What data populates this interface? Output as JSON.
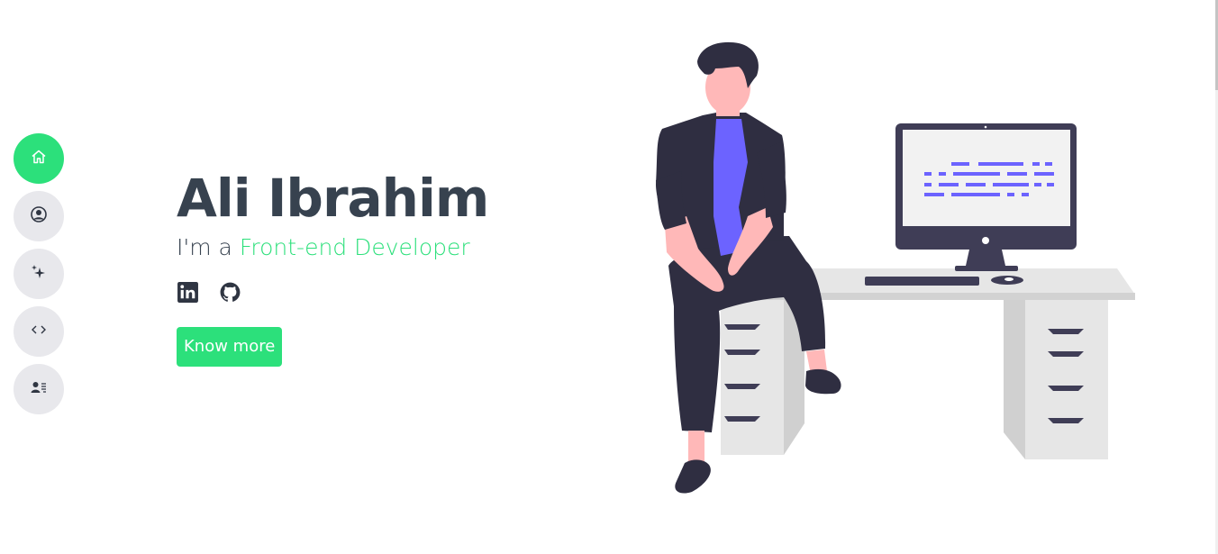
{
  "nav": {
    "items": [
      {
        "name": "home",
        "icon": "home-icon",
        "active": true
      },
      {
        "name": "about",
        "icon": "user-circle-icon",
        "active": false
      },
      {
        "name": "skills",
        "icon": "sparkles-icon",
        "active": false
      },
      {
        "name": "projects",
        "icon": "code-icon",
        "active": false
      },
      {
        "name": "contact",
        "icon": "contact-card-icon",
        "active": false
      }
    ]
  },
  "hero": {
    "name": "Ali Ibrahim",
    "role_prefix": "I'm a ",
    "role_highlight": "Front-end Developer",
    "cta_label": "Know more"
  },
  "socials": [
    {
      "name": "linkedin",
      "icon": "linkedin-icon"
    },
    {
      "name": "github",
      "icon": "github-icon"
    }
  ],
  "colors": {
    "accent": "#2ce07b",
    "text": "#37424f",
    "nav_bg": "#e8e8ec",
    "illustration_purple": "#6c63ff"
  }
}
